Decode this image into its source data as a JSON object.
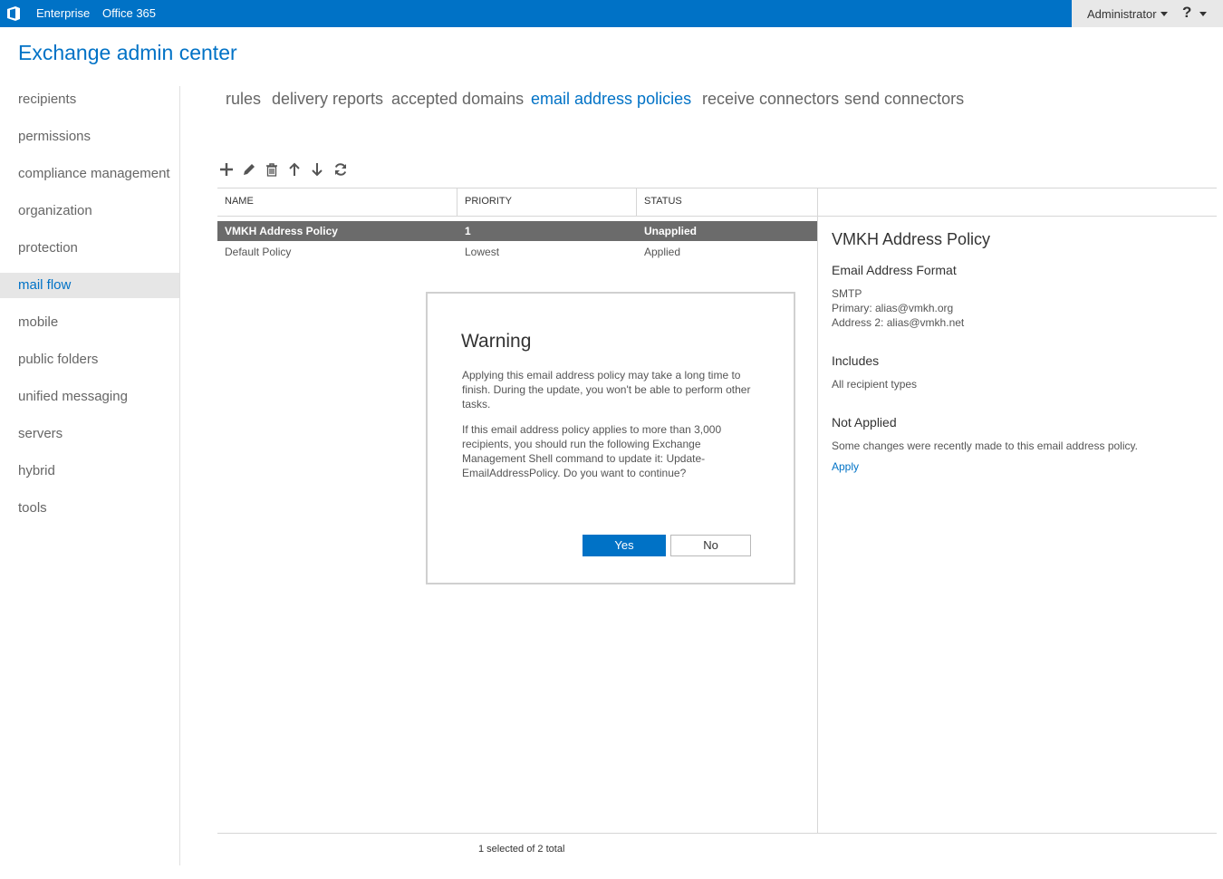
{
  "topbar": {
    "links": [
      "Enterprise",
      "Office 365"
    ],
    "user": "Administrator",
    "help": "?"
  },
  "app_title": "Exchange admin center",
  "leftnav": {
    "items": [
      "recipients",
      "permissions",
      "compliance management",
      "organization",
      "protection",
      "mail flow",
      "mobile",
      "public folders",
      "unified messaging",
      "servers",
      "hybrid",
      "tools"
    ],
    "selected": "mail flow"
  },
  "tabs": {
    "items": [
      "rules",
      "delivery reports",
      "accepted domains",
      "email address policies",
      "receive connectors",
      "send connectors"
    ],
    "active": "email address policies"
  },
  "toolbar": {
    "icons": [
      "add-icon",
      "edit-icon",
      "delete-icon",
      "move-up-icon",
      "move-down-icon",
      "refresh-icon"
    ]
  },
  "table": {
    "headers": [
      "NAME",
      "PRIORITY",
      "STATUS"
    ],
    "rows": [
      {
        "name": "VMKH Address Policy",
        "priority": "1",
        "status": "Unapplied",
        "selected": true
      },
      {
        "name": "Default Policy",
        "priority": "Lowest",
        "status": "Applied",
        "selected": false
      }
    ]
  },
  "details": {
    "title": "VMKH Address Policy",
    "format_heading": "Email Address Format",
    "format_type": "SMTP",
    "primary": "Primary: alias@vmkh.org",
    "address2": "Address 2: alias@vmkh.net",
    "includes_heading": "Includes",
    "includes_value": "All recipient types",
    "status_heading": "Not Applied",
    "status_text": "Some changes were recently made to this email address policy.",
    "apply_link": "Apply"
  },
  "dialog": {
    "title": "Warning",
    "para1_lines": [
      "Applying this email address policy may take a long time to",
      "finish. During the update, you won't be able to perform other",
      "tasks."
    ],
    "para2_lines": [
      "If this email address policy applies to more than 3,000",
      "recipients, you should run the following Exchange",
      "Management Shell command to update it: Update-",
      "EmailAddressPolicy. Do you want to continue?"
    ],
    "yes": "Yes",
    "no": "No"
  },
  "footer": "1 selected of 2 total",
  "colors": {
    "accent": "#0072c6",
    "selected_row": "#6b6b6b",
    "nav_selected": "#e6e6e6"
  }
}
